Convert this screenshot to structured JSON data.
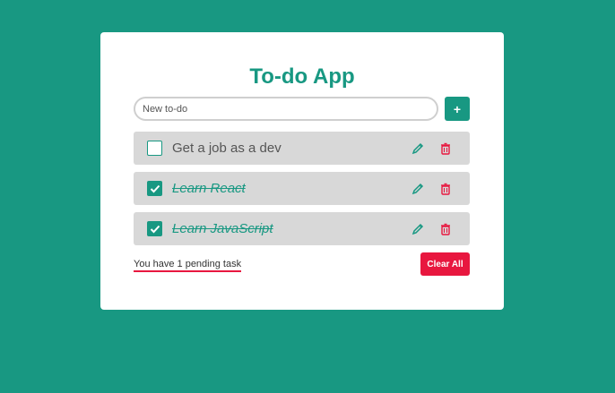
{
  "app": {
    "title": "To-do App"
  },
  "new_todo": {
    "placeholder": "New to-do",
    "add_label": "+"
  },
  "todos": [
    {
      "text": "Get a job as a dev",
      "completed": false
    },
    {
      "text": "Learn React",
      "completed": true
    },
    {
      "text": "Learn JavaScript",
      "completed": true
    }
  ],
  "footer": {
    "pending_text": "You have 1 pending task",
    "clear_label": "Clear All"
  },
  "colors": {
    "background": "#189882",
    "accent": "#189882",
    "danger": "#e8173f",
    "item_bg": "#d8d8d8"
  },
  "icons": {
    "edit": "pencil-icon",
    "delete": "trash-icon",
    "check": "check-icon"
  }
}
